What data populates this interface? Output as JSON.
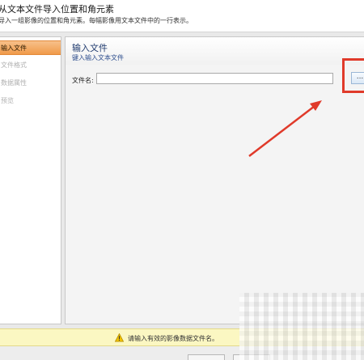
{
  "header": {
    "title": "从文本文件导入位置和角元素",
    "subtitle": "导入一组影像的位置和角元素。每幅影像用文本文件中的一行表示。"
  },
  "sidebar": {
    "items": [
      {
        "label": "输入文件",
        "active": true
      },
      {
        "label": "文件格式",
        "active": false
      },
      {
        "label": "数据属性",
        "active": false
      },
      {
        "label": "预览",
        "active": false
      }
    ]
  },
  "main": {
    "title": "输入文件",
    "subtitle": "键入输入文本文件",
    "file_label": "文件名:",
    "file_value": "",
    "browse_label": "..."
  },
  "status": {
    "warning": "请输入有效的影像数据文件名。"
  },
  "colors": {
    "accent_orange": "#f09a4a",
    "highlight_red": "#e03a2a",
    "warning_bg": "#fbf7c2"
  }
}
